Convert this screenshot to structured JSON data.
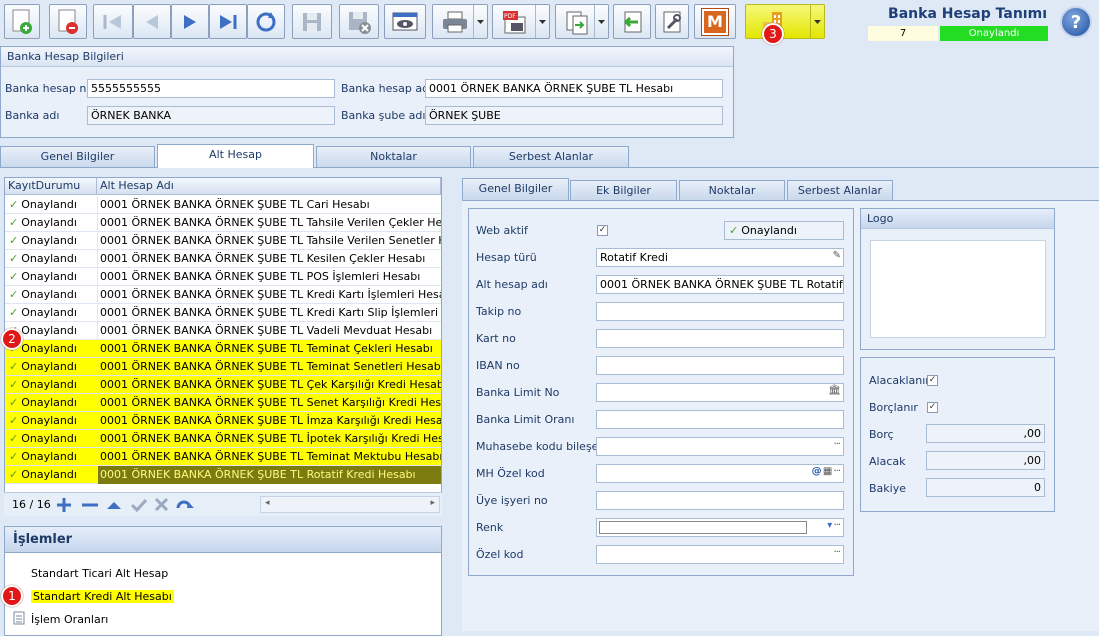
{
  "toolbar": {
    "icons": [
      "new-icon",
      "delete-icon",
      "first-icon",
      "prev-icon",
      "next-icon",
      "last-icon",
      "refresh-icon",
      "save-icon",
      "cancel-save-icon",
      "preview-icon",
      "print-icon",
      "pdf-icon",
      "export-icon",
      "back-icon",
      "tools-icon",
      "m-icon",
      "report-icon"
    ],
    "m_label": "M"
  },
  "header": {
    "title": "Banka Hesap Tanımı",
    "record_no": "7",
    "status": "Onaylandı",
    "help": "?"
  },
  "badges": {
    "b1": "1",
    "b2": "2",
    "b3": "3"
  },
  "bank_group": {
    "title": "Banka Hesap Bilgileri",
    "hesap_no_label": "Banka hesap no",
    "hesap_no": "5555555555",
    "hesap_adi_label": "Banka hesap adı",
    "hesap_adi": "0001 ÖRNEK BANKA ÖRNEK ŞUBE TL Hesabı",
    "banka_adi_label": "Banka adı",
    "banka_adi": "ÖRNEK BANKA",
    "sube_adi_label": "Banka şube adı",
    "sube_adi": "ÖRNEK ŞUBE"
  },
  "main_tabs": [
    "Genel Bilgiler",
    "Alt Hesap",
    "Noktalar",
    "Serbest Alanlar"
  ],
  "grid": {
    "col1": "KayıtDurumu",
    "col2": "Alt Hesap Adı",
    "rows": [
      {
        "status": "Onaylandı",
        "name": "0001 ÖRNEK BANKA ÖRNEK ŞUBE TL Cari Hesabı"
      },
      {
        "status": "Onaylandı",
        "name": "0001 ÖRNEK BANKA ÖRNEK ŞUBE TL Tahsile Verilen Çekler Hesabı"
      },
      {
        "status": "Onaylandı",
        "name": "0001 ÖRNEK BANKA ÖRNEK ŞUBE TL Tahsile Verilen Senetler Hesabı"
      },
      {
        "status": "Onaylandı",
        "name": "0001 ÖRNEK BANKA ÖRNEK ŞUBE TL Kesilen Çekler Hesabı"
      },
      {
        "status": "Onaylandı",
        "name": "0001 ÖRNEK BANKA ÖRNEK ŞUBE TL POS İşlemleri Hesabı"
      },
      {
        "status": "Onaylandı",
        "name": "0001 ÖRNEK BANKA ÖRNEK ŞUBE TL Kredi Kartı İşlemleri Hesabı"
      },
      {
        "status": "Onaylandı",
        "name": "0001 ÖRNEK BANKA ÖRNEK ŞUBE TL Kredi Kartı Slip İşlemleri Hesabı"
      },
      {
        "status": "Onaylandı",
        "name": "0001 ÖRNEK BANKA ÖRNEK ŞUBE TL Vadeli Mevduat Hesabı"
      },
      {
        "status": "Onaylandı",
        "name": "0001 ÖRNEK BANKA ÖRNEK ŞUBE TL Teminat Çekleri Hesabı"
      },
      {
        "status": "Onaylandı",
        "name": "0001 ÖRNEK BANKA ÖRNEK ŞUBE TL Teminat Senetleri Hesabı"
      },
      {
        "status": "Onaylandı",
        "name": "0001 ÖRNEK BANKA ÖRNEK ŞUBE TL Çek Karşılığı Kredi Hesabı"
      },
      {
        "status": "Onaylandı",
        "name": "0001 ÖRNEK BANKA ÖRNEK ŞUBE TL Senet Karşılığı Kredi Hesabı"
      },
      {
        "status": "Onaylandı",
        "name": "0001 ÖRNEK BANKA ÖRNEK ŞUBE TL İmza Karşılığı Kredi Hesabı"
      },
      {
        "status": "Onaylandı",
        "name": "0001 ÖRNEK BANKA ÖRNEK ŞUBE TL İpotek Karşılığı Kredi Hesabı"
      },
      {
        "status": "Onaylandı",
        "name": "0001 ÖRNEK BANKA ÖRNEK ŞUBE TL Teminat Mektubu Hesabı"
      },
      {
        "status": "Onaylandı",
        "name": "0001 ÖRNEK BANKA ÖRNEK ŞUBE TL Rotatif Kredi Hesabı"
      }
    ],
    "counter": "16 / 16"
  },
  "islemler": {
    "title": "İşlemler",
    "items": [
      "Standart Ticari Alt Hesap",
      "Standart Kredi Alt Hesabı",
      "İşlem Oranları"
    ]
  },
  "sub_tabs": [
    "Genel Bilgiler",
    "Ek Bilgiler",
    "Noktalar",
    "Serbest Alanlar"
  ],
  "form": {
    "web_aktif_label": "Web aktif",
    "onay_label": "Onaylandı",
    "hesap_turu_label": "Hesap türü",
    "hesap_turu": "Rotatif Kredi",
    "alt_hesap_adi_label": "Alt hesap adı",
    "alt_hesap_adi": "0001 ÖRNEK BANKA ÖRNEK ŞUBE TL Rotatif Kredi H",
    "takip_no_label": "Takip no",
    "kart_no_label": "Kart no",
    "iban_label": "IBAN no",
    "limit_no_label": "Banka Limit No",
    "limit_orani_label": "Banka Limit Oranı",
    "muhasebe_label": "Muhasebe kodu bileşeni",
    "mh_ozel_label": "MH Özel kod",
    "uye_label": "Üye işyeri no",
    "renk_label": "Renk",
    "ozel_kod_label": "Özel kod"
  },
  "logo": {
    "title": "Logo"
  },
  "totals": {
    "alacaklanir_label": "Alacaklanır",
    "borclanir_label": "Borçlanır",
    "borc_label": "Borç",
    "borc": ",00",
    "alacak_label": "Alacak",
    "alacak": ",00",
    "bakiye_label": "Bakiye",
    "bakiye": "0"
  },
  "colors": {
    "highlight": "#ffff00",
    "status_green": "#22dd22",
    "badge": "#e01818",
    "selected_row": "#7b7b10"
  }
}
